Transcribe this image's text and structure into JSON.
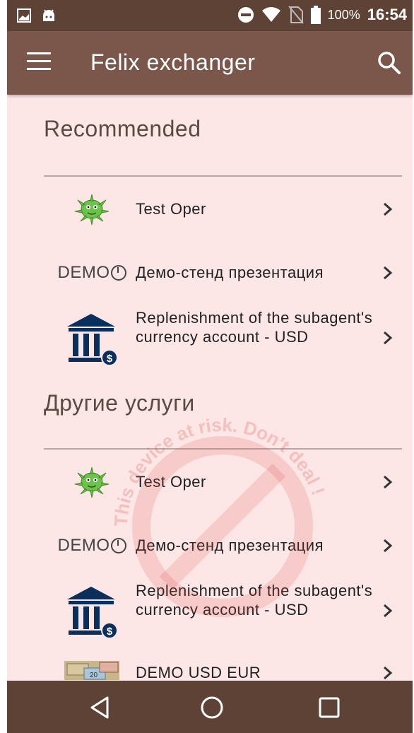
{
  "status_bar": {
    "battery": "100%",
    "time": "16:54"
  },
  "app_bar": {
    "title": "Felix exchanger"
  },
  "sections": [
    {
      "title": "Recommended",
      "items": [
        {
          "label": "Test Oper",
          "icon": "virus-icon"
        },
        {
          "label": "Демо-стенд презентация",
          "icon": "demo-logo"
        },
        {
          "label": "Replenishment of the subagent's currency account - USD",
          "icon": "bank-dollar-icon"
        }
      ]
    },
    {
      "title": "Другие услуги",
      "items": [
        {
          "label": "Test Oper",
          "icon": "virus-icon"
        },
        {
          "label": "Демо-стенд презентация",
          "icon": "demo-logo"
        },
        {
          "label": "Replenishment of the subagent's currency account - USD",
          "icon": "bank-dollar-icon"
        },
        {
          "label": "DEMO USD EUR",
          "icon": "banknotes-icon"
        }
      ]
    }
  ],
  "demo_logo_text": "DEMO",
  "watermark_text": "This device at risk. Don't deal !",
  "colors": {
    "status_bar": "#5e4236",
    "app_bar": "#7a574a",
    "background": "#fce7e6",
    "accent_green": "#6cc24a",
    "bank_icon": "#0a2f5c",
    "watermark_red": "#e05050"
  }
}
